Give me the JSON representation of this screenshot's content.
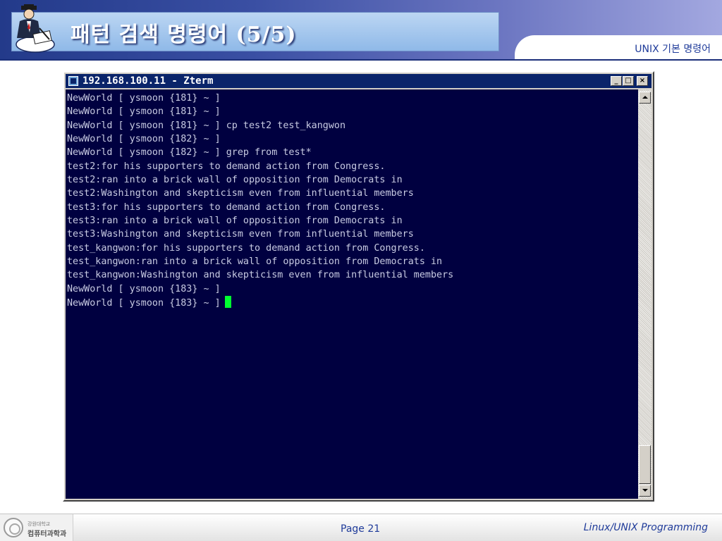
{
  "slide": {
    "title": "패턴 검색 명령어 (5/5)",
    "subtitle": "UNIX 기본 명령어"
  },
  "terminal": {
    "window_title": "192.168.100.11 - Zterm",
    "buttons": {
      "minimize": "_",
      "maximize": "□",
      "close": "×"
    },
    "lines": [
      "NewWorld [ ysmoon {181} ~ ]",
      "NewWorld [ ysmoon {181} ~ ]",
      "NewWorld [ ysmoon {181} ~ ] cp test2 test_kangwon",
      "NewWorld [ ysmoon {182} ~ ]",
      "NewWorld [ ysmoon {182} ~ ] grep from test*",
      "test2:for his supporters to demand action from Congress.",
      "test2:ran into a brick wall of opposition from Democrats in",
      "test2:Washington and skepticism even from influential members",
      "test3:for his supporters to demand action from Congress.",
      "test3:ran into a brick wall of opposition from Democrats in",
      "test3:Washington and skepticism even from influential members",
      "test_kangwon:for his supporters to demand action from Congress.",
      "test_kangwon:ran into a brick wall of opposition from Democrats in",
      "test_kangwon:Washington and skepticism even from influential members",
      "NewWorld [ ysmoon {183} ~ ]",
      "NewWorld [ ysmoon {183} ~ ]"
    ],
    "colors": {
      "background": "#000040",
      "text": "#c8cbe2",
      "cursor": "#00ff30"
    }
  },
  "footer": {
    "university": "강원대학교",
    "department": "컴퓨터과학과",
    "page": "Page 21",
    "course": "Linux/UNIX Programming"
  },
  "colors": {
    "accent": "#1f3b9a",
    "banner": "#233a8a"
  }
}
